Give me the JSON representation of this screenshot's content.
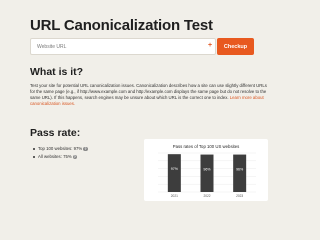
{
  "page": {
    "title": "URL Canonicalization Test"
  },
  "form": {
    "input_placeholder": "Website URL",
    "input_value": "",
    "plus_icon": "plus-icon",
    "button_label": "Checkup"
  },
  "what_section": {
    "heading": "What is it?",
    "body": "Test your site for potential URL canonicalization issues. Canonicalization describes how a site can use slightly different URLs for the same page (e.g., if http://www.example.com and http://example.com displays the same page but do not resolve to the same URL). If this happens, search engines may be unsure about which URL is the correct one to index. ",
    "link_label": "Learn more about canonicalization issues."
  },
  "pass_rate": {
    "heading": "Pass rate:",
    "items": [
      {
        "label": "Top 100 websites: 97%",
        "icon": "info-icon"
      },
      {
        "label": "All websites: 75%",
        "icon": "info-icon"
      }
    ]
  },
  "colors": {
    "accent": "#e8591f",
    "background": "#f1efe9",
    "bar": "#3d3d3d"
  },
  "chart_data": {
    "type": "bar",
    "title": "Pass rates of Top 100 US websites",
    "categories": [
      "2021",
      "2022",
      "2023"
    ],
    "values": [
      97,
      96,
      96
    ],
    "data_labels": [
      "97%",
      "96%",
      "96%"
    ],
    "ylim": [
      0,
      100
    ],
    "grid": true,
    "legend": "none"
  }
}
